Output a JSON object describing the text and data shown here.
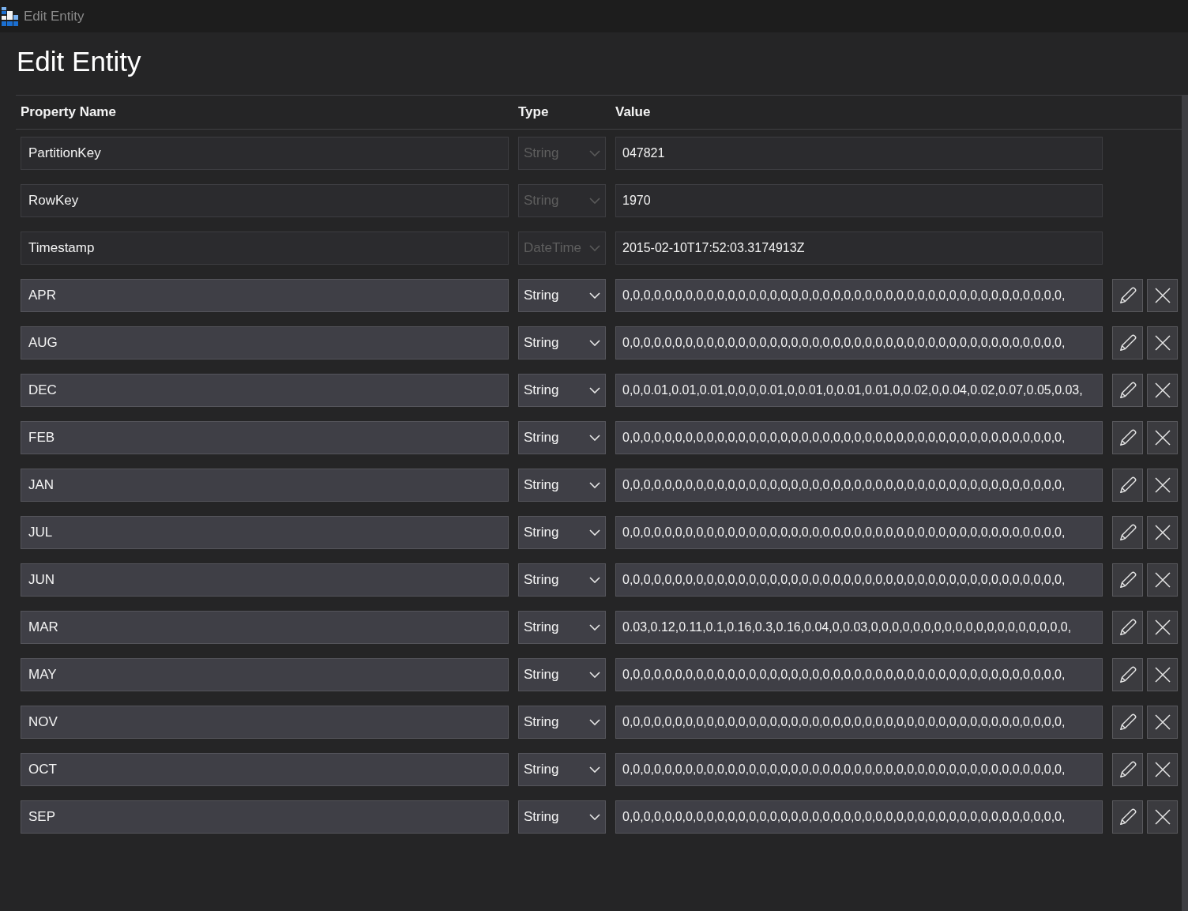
{
  "window": {
    "title": "Edit Entity"
  },
  "heading": "Edit Entity",
  "table": {
    "columns": [
      "Property Name",
      "Type",
      "Value"
    ],
    "rows": [
      {
        "name": "PartitionKey",
        "type": "String",
        "value": "047821",
        "readonly": true
      },
      {
        "name": "RowKey",
        "type": "String",
        "value": "1970",
        "readonly": true
      },
      {
        "name": "Timestamp",
        "type": "DateTime",
        "value": "2015-02-10T17:52:03.3174913Z",
        "readonly": true
      },
      {
        "name": "APR",
        "type": "String",
        "value": "0,0,0,0,0,0,0,0,0,0,0,0,0,0,0,0,0,0,0,0,0,0,0,0,0,0,0,0,0,0,0,0,0,0,0,0,0,0,0,0,0,0,",
        "readonly": false
      },
      {
        "name": "AUG",
        "type": "String",
        "value": "0,0,0,0,0,0,0,0,0,0,0,0,0,0,0,0,0,0,0,0,0,0,0,0,0,0,0,0,0,0,0,0,0,0,0,0,0,0,0,0,0,0,",
        "readonly": false
      },
      {
        "name": "DEC",
        "type": "String",
        "value": "0,0,0.01,0.01,0.01,0,0,0,0.01,0,0.01,0,0.01,0.01,0,0.02,0,0.04,0.02,0.07,0.05,0.03,",
        "readonly": false
      },
      {
        "name": "FEB",
        "type": "String",
        "value": "0,0,0,0,0,0,0,0,0,0,0,0,0,0,0,0,0,0,0,0,0,0,0,0,0,0,0,0,0,0,0,0,0,0,0,0,0,0,0,0,0,0,",
        "readonly": false
      },
      {
        "name": "JAN",
        "type": "String",
        "value": "0,0,0,0,0,0,0,0,0,0,0,0,0,0,0,0,0,0,0,0,0,0,0,0,0,0,0,0,0,0,0,0,0,0,0,0,0,0,0,0,0,0,",
        "readonly": false
      },
      {
        "name": "JUL",
        "type": "String",
        "value": "0,0,0,0,0,0,0,0,0,0,0,0,0,0,0,0,0,0,0,0,0,0,0,0,0,0,0,0,0,0,0,0,0,0,0,0,0,0,0,0,0,0,",
        "readonly": false
      },
      {
        "name": "JUN",
        "type": "String",
        "value": "0,0,0,0,0,0,0,0,0,0,0,0,0,0,0,0,0,0,0,0,0,0,0,0,0,0,0,0,0,0,0,0,0,0,0,0,0,0,0,0,0,0,",
        "readonly": false
      },
      {
        "name": "MAR",
        "type": "String",
        "value": "0.03,0.12,0.11,0.1,0.16,0.3,0.16,0.04,0,0.03,0,0,0,0,0,0,0,0,0,0,0,0,0,0,0,0,0,0,0,",
        "readonly": false
      },
      {
        "name": "MAY",
        "type": "String",
        "value": "0,0,0,0,0,0,0,0,0,0,0,0,0,0,0,0,0,0,0,0,0,0,0,0,0,0,0,0,0,0,0,0,0,0,0,0,0,0,0,0,0,0,",
        "readonly": false
      },
      {
        "name": "NOV",
        "type": "String",
        "value": "0,0,0,0,0,0,0,0,0,0,0,0,0,0,0,0,0,0,0,0,0,0,0,0,0,0,0,0,0,0,0,0,0,0,0,0,0,0,0,0,0,0,",
        "readonly": false
      },
      {
        "name": "OCT",
        "type": "String",
        "value": "0,0,0,0,0,0,0,0,0,0,0,0,0,0,0,0,0,0,0,0,0,0,0,0,0,0,0,0,0,0,0,0,0,0,0,0,0,0,0,0,0,0,",
        "readonly": false
      },
      {
        "name": "SEP",
        "type": "String",
        "value": "0,0,0,0,0,0,0,0,0,0,0,0,0,0,0,0,0,0,0,0,0,0,0,0,0,0,0,0,0,0,0,0,0,0,0,0,0,0,0,0,0,0,",
        "readonly": false
      }
    ]
  }
}
